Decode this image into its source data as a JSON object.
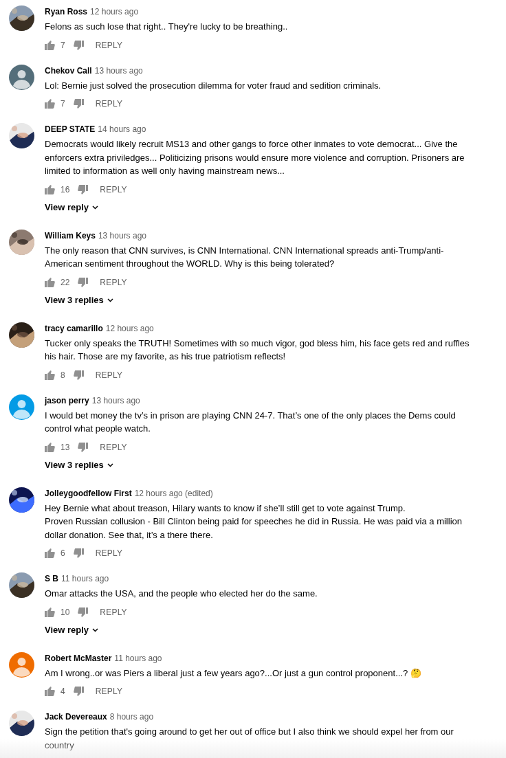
{
  "comments": [
    {
      "author": "Ryan Ross",
      "time": "12 hours ago",
      "text": "Felons as such lose that right.. They're lucky to be breathing..",
      "likes": "7",
      "reply": "REPLY"
    },
    {
      "author": "Chekov Call",
      "time": "13 hours ago",
      "text": "Lol: Bernie just solved the prosecution dilemma for voter fraud and sedition criminals.",
      "likes": "7",
      "reply": "REPLY",
      "avatar": {
        "kind": "default",
        "color": "#546e7a"
      }
    },
    {
      "author": "DEEP STATE",
      "time": "14 hours ago",
      "text": "Democrats would likely recruit MS13 and other gangs to force other inmates to vote democrat... Give the enforcers extra priviledges... Politicizing prisons would ensure more violence and corruption. Prisoners are limited to information as well only having mainstream news...",
      "likes": "16",
      "reply": "REPLY",
      "replies": "View reply"
    },
    {
      "author": "William Keys",
      "time": "13 hours ago",
      "text": "The only reason that CNN survives, is CNN International.  CNN International spreads anti-Trump/anti-American sentiment throughout the WORLD.  Why is this being tolerated?",
      "likes": "22",
      "reply": "REPLY",
      "replies": "View 3 replies"
    },
    {
      "author": "tracy camarillo",
      "time": "12 hours ago",
      "text": "Tucker only speaks the TRUTH! Sometimes with so much vigor, god bless him, his face gets red and ruffles his hair. Those are my favorite, as his true patriotism reflects!",
      "likes": "8",
      "reply": "REPLY"
    },
    {
      "author": "jason perry",
      "time": "13 hours ago",
      "text": "I would bet money the tv’s in prison are playing CNN 24-7. That’s one of the only places the Dems could control what people watch.",
      "likes": "13",
      "reply": "REPLY",
      "replies": "View 3 replies",
      "avatar": {
        "kind": "default",
        "color": "#039be5"
      }
    },
    {
      "author": "Jolleygoodfellow First",
      "time": "12 hours ago (edited)",
      "text": "Hey Bernie what about treason, Hilary wants to know if she’ll still get to vote against Trump.\nProven Russian collusion - Bill Clinton being paid for speeches he did in Russia. He was paid via a million dollar donation. See that, it’s a there there.",
      "likes": "6",
      "reply": "REPLY"
    },
    {
      "author": "S B",
      "time": "11 hours ago",
      "text": "Omar attacks the USA, and the people who elected her do the same.",
      "likes": "10",
      "reply": "REPLY",
      "replies": "View reply"
    },
    {
      "author": "Robert McMaster",
      "time": "11 hours ago",
      "text": "Am I wrong..or was Piers a liberal just a few years ago?...Or just a gun control proponent...? 🤔",
      "likes": "4",
      "reply": "REPLY",
      "avatar": {
        "kind": "default",
        "color": "#ef6c00"
      }
    },
    {
      "author": "Jack Devereaux",
      "time": "8 hours ago",
      "text": "Sign the petition that's going around to get her out of office but I also think we should expel her from our country"
    }
  ]
}
